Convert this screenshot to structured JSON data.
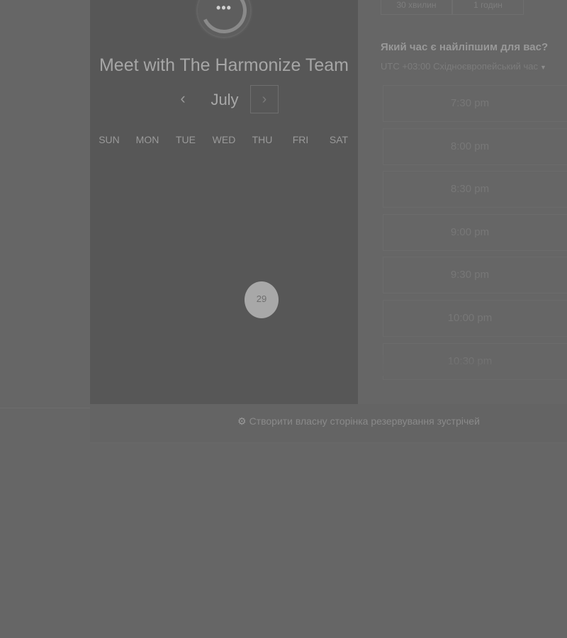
{
  "booking": {
    "title": "Meet with The Harmonize Team",
    "avatar_icon": "chat-dots",
    "month_nav": {
      "prev_icon": "‹",
      "month": "July",
      "next_icon": "›"
    },
    "weekdays": [
      "SUN",
      "MON",
      "TUE",
      "WED",
      "THU",
      "FRI",
      "SAT"
    ],
    "available_days": [
      {
        "day": "29",
        "weekday": "THU"
      }
    ]
  },
  "durations": [
    {
      "label": "30 хвилин"
    },
    {
      "label": "1 годин"
    }
  ],
  "times": {
    "question": "Який час є найліпшим для вас?",
    "timezone": "UTC +03:00 Східноєвропейський час",
    "slots": [
      "7:30 pm",
      "8:00 pm",
      "8:30 pm",
      "9:00 pm",
      "9:30 pm",
      "10:00 pm",
      "10:30 pm"
    ]
  },
  "footer": {
    "link_label": "Створити власну сторінка резервування зустрічей",
    "icon": "hubspot-sprocket"
  },
  "colors": {
    "overlay": "#666666",
    "panel": "#575757",
    "selected_day": "#a8a8a8"
  }
}
